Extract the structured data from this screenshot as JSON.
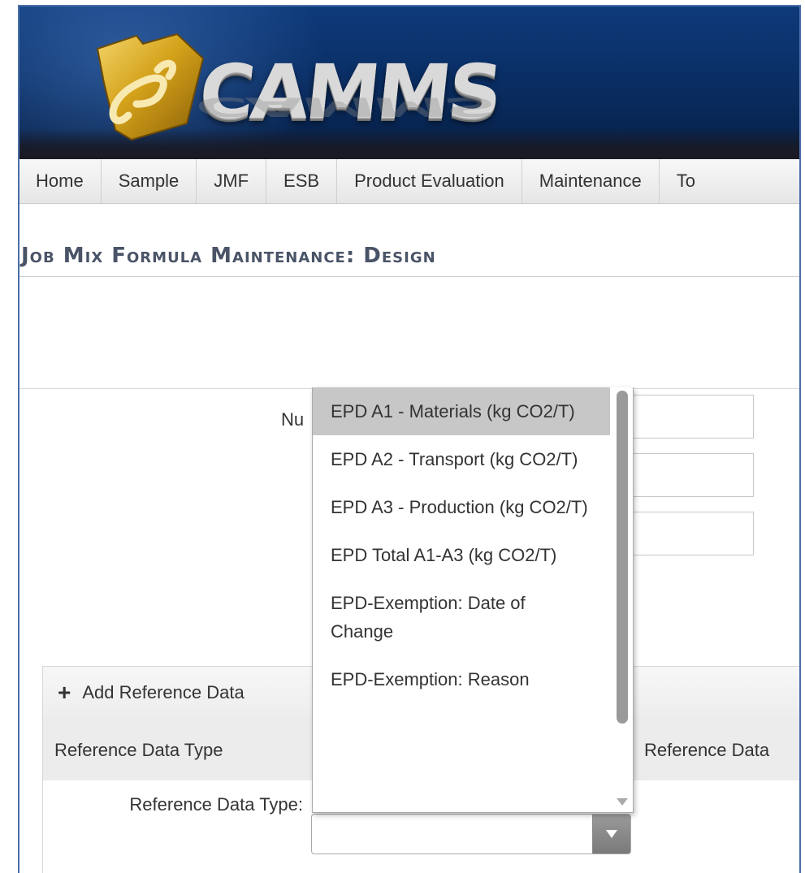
{
  "app": {
    "logo_text": "CAMMS"
  },
  "nav": {
    "items": [
      {
        "label": "Home"
      },
      {
        "label": "Sample"
      },
      {
        "label": "JMF"
      },
      {
        "label": "ESB"
      },
      {
        "label": "Product Evaluation"
      },
      {
        "label": "Maintenance"
      },
      {
        "label": "To"
      }
    ]
  },
  "page": {
    "title": "Job Mix Formula Maintenance: Design"
  },
  "form": {
    "partial_label": "Nu"
  },
  "dropdown": {
    "options": [
      {
        "label": "EPD A1 - Materials (kg CO2/T)",
        "selected": true
      },
      {
        "label": "EPD A2 - Transport (kg CO2/T)",
        "selected": false
      },
      {
        "label": "EPD A3 - Production (kg CO2/T)",
        "selected": false
      },
      {
        "label": "EPD Total A1-A3 (kg CO2/T)",
        "selected": false
      },
      {
        "label": "EPD-Exemption: Date of Change",
        "selected": false
      },
      {
        "label": "EPD-Exemption: Reason",
        "selected": false
      }
    ]
  },
  "reference": {
    "add_label": "Add Reference Data",
    "col_type": "Reference Data Type",
    "col_data": "Reference Data",
    "field_label": "Reference Data Type:",
    "field_value": ""
  },
  "colors": {
    "banner": "#0a2f66",
    "accent_gold": "#d4a21a",
    "selected_option": "#c7c7c7"
  }
}
